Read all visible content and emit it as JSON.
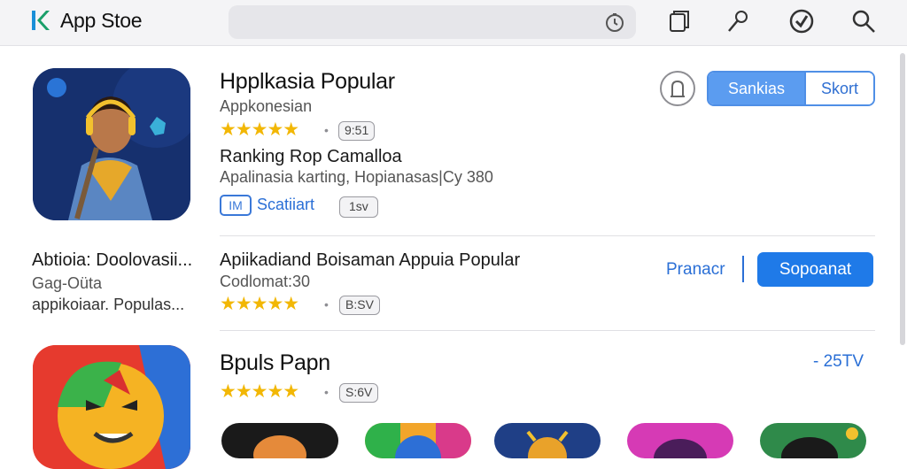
{
  "header": {
    "brand": "App Stoe",
    "icons": [
      "clock-icon",
      "copy-icon",
      "pencil-icon",
      "badge-icon",
      "search-icon"
    ]
  },
  "app1": {
    "title": "Hpplkasia Popular",
    "subtitle": "Appkonesian",
    "rating_badge": "9:51",
    "ranking_title": "Ranking Rop Camalloa",
    "ranking_sub": "Apalinasia karting, Hopianasas|Cy 380",
    "tag_icon": "IM",
    "tag_label": "Scatiiart",
    "version": "1sv",
    "seg_on": "Sankias",
    "seg_off": "Skort"
  },
  "side_text": {
    "line1": "Abtioia: Doolovasii...",
    "line2": "Gag-Oüta",
    "line3": "appikoiaar. Populas..."
  },
  "app2": {
    "title": "Apiikadiand Boisaman Appuia Popular",
    "subtitle": "Codlomat:30",
    "rating_badge": "B:SV",
    "link": "Pranacr",
    "button": "Sopoanat"
  },
  "app3": {
    "title": "Bpuls Papn",
    "rating_badge": "S:6V",
    "side_value": "- 25TV"
  },
  "colors": {
    "accent": "#1f7ae8",
    "star": "#f2b705"
  }
}
